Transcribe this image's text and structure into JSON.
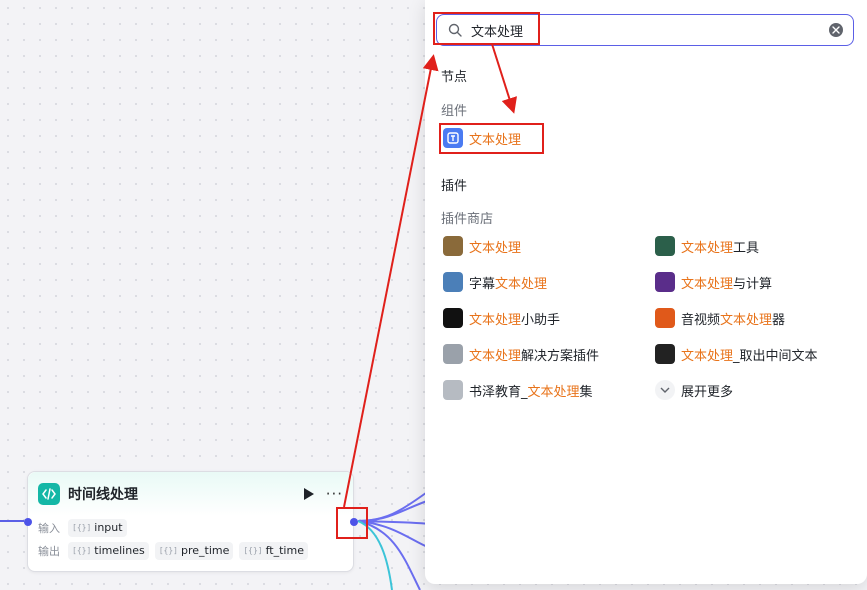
{
  "node": {
    "title": "时间线处理",
    "icon": "code-icon",
    "input_label": "输入",
    "output_label": "输出",
    "inputs": [
      "input"
    ],
    "outputs": [
      "timelines",
      "pre_time",
      "ft_time"
    ],
    "accent": "#14b7a6"
  },
  "panel": {
    "search_value": "文本处理",
    "section_nodes": "节点",
    "sub_components": "组件",
    "component_item": "文本处理",
    "section_plugins": "插件",
    "sub_store": "插件商店",
    "plugins": [
      {
        "pre": "",
        "hl": "文本处理",
        "post": "",
        "icon": "text-processing-plugin-icon"
      },
      {
        "pre": "",
        "hl": "文本处理",
        "post": "工具",
        "icon": "text-tool-plugin-icon"
      },
      {
        "pre": "字幕",
        "hl": "文本处理",
        "post": "",
        "icon": "subtitle-plugin-icon"
      },
      {
        "pre": "",
        "hl": "文本处理",
        "post": "与计算",
        "icon": "text-calc-plugin-icon"
      },
      {
        "pre": "",
        "hl": "文本处理",
        "post": "小助手",
        "icon": "assistant-plugin-icon"
      },
      {
        "pre": "音视频",
        "hl": "文本处理",
        "post": "器",
        "icon": "av-plugin-icon"
      },
      {
        "pre": "",
        "hl": "文本处理",
        "post": "解决方案插件",
        "icon": "solution-plugin-icon"
      },
      {
        "pre": "",
        "hl": "文本处理",
        "post": "_取出中间文本",
        "icon": "extract-plugin-icon"
      },
      {
        "pre": "书泽教育_",
        "hl": "文本处理",
        "post": "集",
        "icon": "education-plugin-icon"
      }
    ],
    "expand_more": "展开更多",
    "highlight_color": "#e8731a",
    "accent": "#5b5fe6"
  },
  "annotation_color": "#e0201b"
}
